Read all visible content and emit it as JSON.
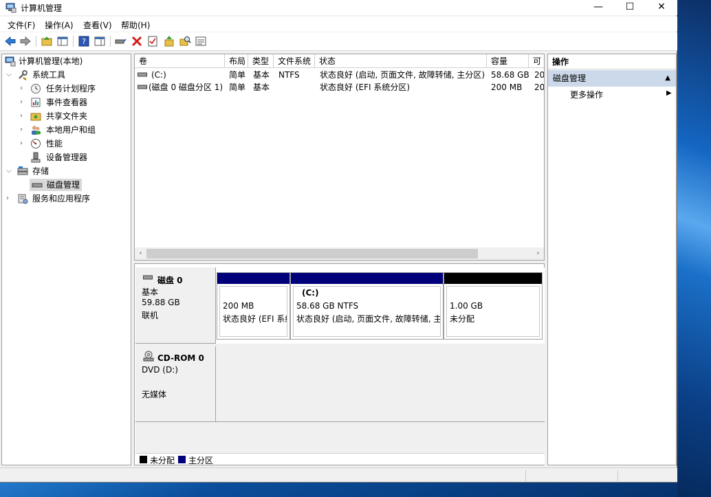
{
  "window": {
    "title": "计算机管理"
  },
  "window_controls": {
    "minimize": "—",
    "maximize": "☐",
    "close": "✕"
  },
  "menu": [
    "文件(F)",
    "操作(A)",
    "查看(V)",
    "帮助(H)"
  ],
  "tree": {
    "root": "计算机管理(本地)",
    "system_tools": "系统工具",
    "task_scheduler": "任务计划程序",
    "event_viewer": "事件查看器",
    "shared_folders": "共享文件夹",
    "local_users": "本地用户和组",
    "performance": "性能",
    "device_manager": "设备管理器",
    "storage": "存储",
    "disk_management": "磁盘管理",
    "services_apps": "服务和应用程序"
  },
  "volume_table": {
    "headers": [
      "卷",
      "布局",
      "类型",
      "文件系统",
      "状态",
      "容量",
      "可"
    ],
    "rows": [
      [
        "(C:)",
        "简单",
        "基本",
        "NTFS",
        "状态良好 (启动, 页面文件, 故障转储, 主分区)",
        "58.68 GB",
        "20"
      ],
      [
        "(磁盘 0 磁盘分区 1)",
        "简单",
        "基本",
        "",
        "状态良好 (EFI 系统分区)",
        "200 MB",
        "20"
      ]
    ]
  },
  "disks": [
    {
      "name": "磁盘 0",
      "type": "基本",
      "size": "59.88 GB",
      "status": "联机",
      "volumes": [
        {
          "title": "",
          "line1": "200 MB",
          "line2": "状态良好 (EFI 系统",
          "bar_color": "#00007b"
        },
        {
          "title": "(C:)",
          "line1": "58.68 GB NTFS",
          "line2": "状态良好 (启动, 页面文件, 故障转储, 主",
          "bar_color": "#00007b"
        },
        {
          "title": "",
          "line1": "1.00 GB",
          "line2": "未分配",
          "bar_color": "#000000"
        }
      ]
    },
    {
      "name": "CD-ROM 0",
      "type": "DVD (D:)",
      "size": "",
      "status": "无媒体"
    }
  ],
  "legend": [
    {
      "label": "未分配",
      "color": "#000000"
    },
    {
      "label": "主分区",
      "color": "#00007b"
    }
  ],
  "actions": {
    "header": "操作",
    "group": "磁盘管理",
    "more": "更多操作"
  }
}
